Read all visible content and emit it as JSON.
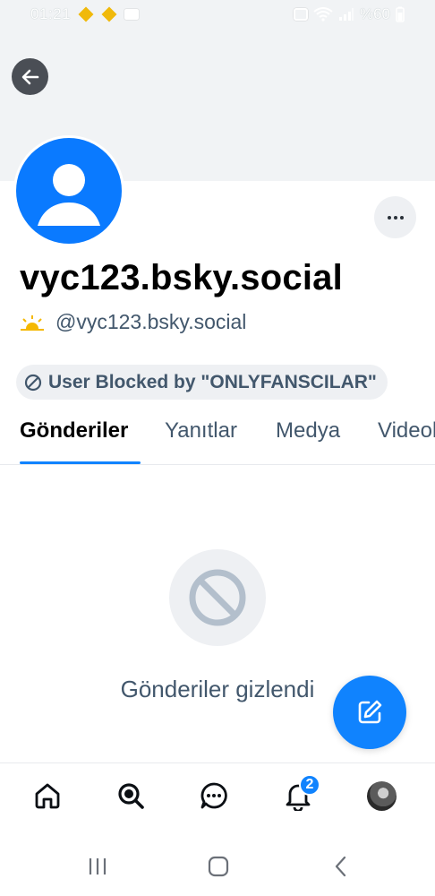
{
  "status_bar": {
    "time": "01:21",
    "battery": "%60"
  },
  "profile": {
    "display_name": "vyc123.bsky.social",
    "handle": "@vyc123.bsky.social",
    "blocked_label": "User Blocked by \"ONLYFANSCILAR\""
  },
  "tabs": [
    {
      "label": "Gönderiler",
      "active": true
    },
    {
      "label": "Yanıtlar",
      "active": false
    },
    {
      "label": "Medya",
      "active": false
    },
    {
      "label": "Videolar",
      "active": false
    }
  ],
  "empty_state": {
    "message": "Gönderiler gizlendi"
  },
  "bottom_nav": {
    "notifications_badge": "2"
  },
  "colors": {
    "accent": "#1083fe",
    "avatar_bg": "#0a7aff",
    "muted_text": "#42576c",
    "pill_bg": "#eef0f3"
  }
}
